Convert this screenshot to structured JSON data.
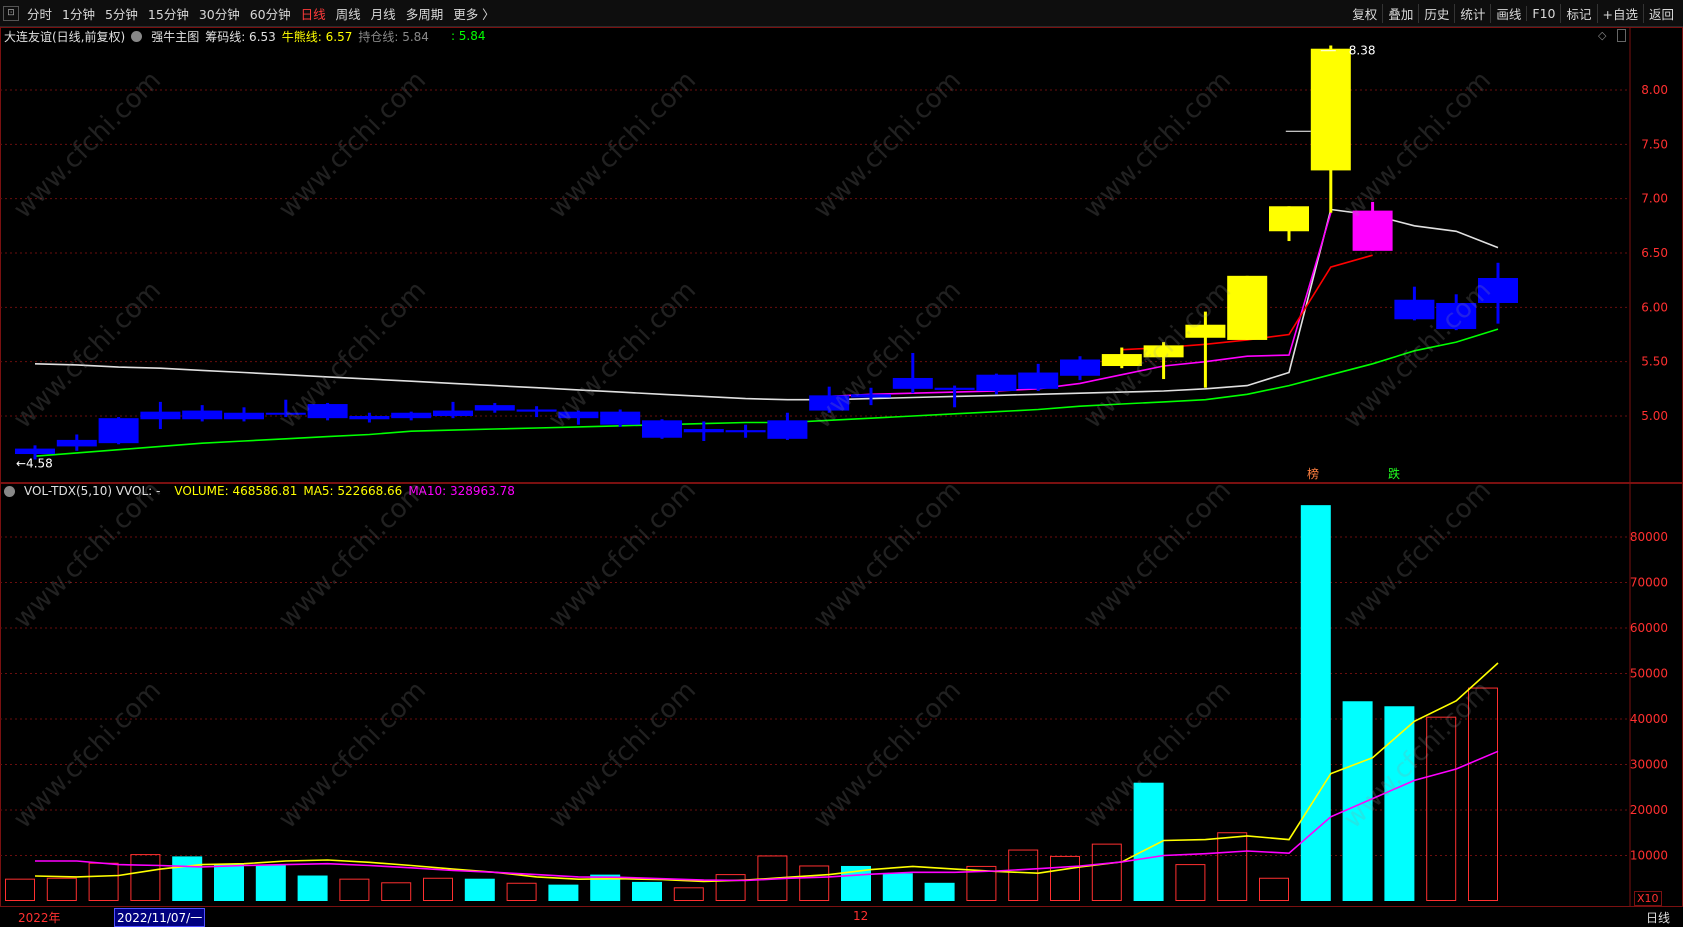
{
  "toolbar": {
    "minimize_glyph": "⊡",
    "periods": [
      "分时",
      "1分钟",
      "5分钟",
      "15分钟",
      "30分钟",
      "60分钟",
      "日线",
      "周线",
      "月线",
      "多周期",
      "更多 〉"
    ],
    "active_period": "日线",
    "tools": [
      "复权",
      "叠加",
      "历史",
      "统计",
      "画线",
      "F10",
      "标记",
      "+自选",
      "返回"
    ]
  },
  "main_panel": {
    "stock_title": "大连友谊(日线,前复权)",
    "indicator_name": "强牛主图",
    "chip_label": "筹码线: 6.53",
    "bull_label": "牛熊线: 6.57",
    "hold_label": "持仓线: 5.84",
    "extra_label": ": 5.84",
    "high_label": "8.38",
    "low_label": "←4.58",
    "marker_bang": "榜",
    "marker_die": "跌",
    "y_ticks": [
      "8.00",
      "7.50",
      "7.00",
      "6.50",
      "6.00",
      "5.50",
      "5.00"
    ]
  },
  "vol_panel": {
    "title": "VOL-TDX(5,10)  VVOL: -",
    "volume_label": "VOLUME: 468586.81",
    "ma5_label": "MA5: 522668.66",
    "ma10_label": "MA10: 328963.78",
    "y_ticks": [
      "80000",
      "70000",
      "60000",
      "50000",
      "40000",
      "30000",
      "20000",
      "10000"
    ],
    "unit": "X10"
  },
  "bottom_axis": {
    "year": "2022年",
    "cursor_date": "2022/11/07/一",
    "month": "12",
    "period_label": "日线"
  },
  "watermark": "www.cfchi.com",
  "colors": {
    "up": "#ffff00",
    "down": "#0000ff",
    "special": "#ff00ff",
    "vol_down": "#00ffff",
    "vol_up": "#ff3030",
    "ma5": "#ffff00",
    "ma10": "#ff00ff",
    "green_line": "#00ff00",
    "red_line": "#ff0000",
    "white_line": "#e0e0e0"
  },
  "chart_data": [
    {
      "type": "candlestick",
      "title": "大连友谊(日线,前复权)",
      "ylim": [
        4.5,
        8.5
      ],
      "candles": [
        {
          "o": 4.7,
          "c": 4.65,
          "h": 4.73,
          "l": 4.6,
          "color": "down"
        },
        {
          "o": 4.78,
          "c": 4.72,
          "h": 4.83,
          "l": 4.68,
          "color": "down"
        },
        {
          "o": 4.98,
          "c": 4.75,
          "h": 4.99,
          "l": 4.74,
          "color": "down"
        },
        {
          "o": 5.04,
          "c": 4.97,
          "h": 5.13,
          "l": 4.88,
          "color": "down"
        },
        {
          "o": 5.05,
          "c": 4.97,
          "h": 5.1,
          "l": 4.95,
          "color": "down"
        },
        {
          "o": 5.03,
          "c": 4.97,
          "h": 5.08,
          "l": 4.95,
          "color": "down"
        },
        {
          "o": 5.03,
          "c": 5.02,
          "h": 5.15,
          "l": 4.99,
          "color": "down"
        },
        {
          "o": 5.11,
          "c": 4.98,
          "h": 5.12,
          "l": 4.96,
          "color": "down"
        },
        {
          "o": 5.0,
          "c": 4.97,
          "h": 5.03,
          "l": 4.94,
          "color": "down"
        },
        {
          "o": 5.03,
          "c": 4.98,
          "h": 5.04,
          "l": 4.96,
          "color": "down"
        },
        {
          "o": 5.05,
          "c": 5.0,
          "h": 5.13,
          "l": 4.98,
          "color": "down"
        },
        {
          "o": 5.1,
          "c": 5.05,
          "h": 5.12,
          "l": 5.03,
          "color": "down"
        },
        {
          "o": 5.06,
          "c": 5.04,
          "h": 5.09,
          "l": 4.99,
          "color": "down"
        },
        {
          "o": 5.04,
          "c": 4.98,
          "h": 5.05,
          "l": 4.92,
          "color": "down"
        },
        {
          "o": 5.04,
          "c": 4.92,
          "h": 5.06,
          "l": 4.9,
          "color": "down"
        },
        {
          "o": 4.96,
          "c": 4.8,
          "h": 4.97,
          "l": 4.79,
          "color": "down"
        },
        {
          "o": 4.88,
          "c": 4.85,
          "h": 4.95,
          "l": 4.77,
          "color": "down"
        },
        {
          "o": 4.87,
          "c": 4.85,
          "h": 4.92,
          "l": 4.8,
          "color": "down"
        },
        {
          "o": 4.96,
          "c": 4.79,
          "h": 5.03,
          "l": 4.78,
          "color": "down"
        },
        {
          "o": 5.19,
          "c": 5.05,
          "h": 5.27,
          "l": 5.03,
          "color": "down"
        },
        {
          "o": 5.2,
          "c": 5.17,
          "h": 5.26,
          "l": 5.1,
          "color": "down"
        },
        {
          "o": 5.35,
          "c": 5.25,
          "h": 5.58,
          "l": 5.21,
          "color": "down"
        },
        {
          "o": 5.26,
          "c": 5.24,
          "h": 5.28,
          "l": 5.08,
          "color": "down"
        },
        {
          "o": 5.38,
          "c": 5.23,
          "h": 5.39,
          "l": 5.2,
          "color": "down"
        },
        {
          "o": 5.4,
          "c": 5.25,
          "h": 5.48,
          "l": 5.23,
          "color": "down"
        },
        {
          "o": 5.52,
          "c": 5.37,
          "h": 5.55,
          "l": 5.33,
          "color": "down"
        },
        {
          "o": 5.46,
          "c": 5.57,
          "h": 5.63,
          "l": 5.44,
          "color": "up"
        },
        {
          "o": 5.54,
          "c": 5.65,
          "h": 5.68,
          "l": 5.34,
          "color": "up"
        },
        {
          "o": 5.72,
          "c": 5.84,
          "h": 5.96,
          "l": 5.26,
          "color": "up"
        },
        {
          "o": 5.7,
          "c": 6.29,
          "h": 6.29,
          "l": 5.7,
          "color": "up"
        },
        {
          "o": 6.7,
          "c": 6.93,
          "h": 6.93,
          "l": 6.61,
          "color": "up"
        },
        {
          "o": 7.26,
          "c": 8.38,
          "h": 8.41,
          "l": 6.87,
          "color": "up"
        },
        {
          "o": 6.89,
          "c": 6.52,
          "h": 6.97,
          "l": 6.52,
          "color": "special"
        },
        {
          "o": 6.07,
          "c": 5.89,
          "h": 6.19,
          "l": 5.88,
          "color": "down"
        },
        {
          "o": 6.04,
          "c": 5.8,
          "h": 6.12,
          "l": 5.79,
          "color": "down"
        },
        {
          "o": 6.27,
          "c": 6.04,
          "h": 6.41,
          "l": 5.85,
          "color": "down"
        }
      ],
      "lines": {
        "white_line": [
          5.48,
          5.47,
          5.45,
          5.44,
          5.42,
          5.4,
          5.38,
          5.36,
          5.34,
          5.32,
          5.3,
          5.28,
          5.26,
          5.24,
          5.22,
          5.2,
          5.18,
          5.16,
          5.15,
          5.15,
          5.16,
          5.17,
          5.18,
          5.19,
          5.2,
          5.21,
          5.22,
          5.23,
          5.25,
          5.28,
          5.4,
          6.9,
          6.85,
          6.75,
          6.7,
          6.55
        ],
        "green_line": [
          4.63,
          4.66,
          4.69,
          4.72,
          4.75,
          4.77,
          4.79,
          4.81,
          4.83,
          4.86,
          4.87,
          4.88,
          4.89,
          4.9,
          4.91,
          4.92,
          4.93,
          4.94,
          4.94,
          4.96,
          4.98,
          5.0,
          5.02,
          5.04,
          5.06,
          5.09,
          5.11,
          5.13,
          5.15,
          5.2,
          5.28,
          5.38,
          5.48,
          5.6,
          5.68,
          5.8
        ],
        "magenta_line": [
          null,
          null,
          null,
          null,
          null,
          null,
          null,
          null,
          null,
          null,
          null,
          null,
          null,
          null,
          null,
          null,
          null,
          null,
          null,
          5.18,
          5.2,
          5.21,
          5.22,
          5.23,
          5.25,
          5.3,
          5.38,
          5.46,
          5.5,
          5.55,
          5.56,
          6.87,
          null,
          null,
          null,
          null
        ],
        "red_line": [
          null,
          null,
          null,
          null,
          null,
          null,
          null,
          null,
          null,
          null,
          null,
          null,
          null,
          null,
          null,
          null,
          null,
          null,
          null,
          null,
          null,
          null,
          null,
          null,
          null,
          null,
          5.61,
          5.63,
          5.66,
          5.7,
          5.75,
          6.37,
          6.48,
          null,
          null,
          null
        ]
      }
    },
    {
      "type": "bar",
      "title": "VOL-TDX(5,10)",
      "ylim": [
        0,
        90000
      ],
      "values": [
        4800,
        5000,
        8300,
        10200,
        9800,
        8100,
        8000,
        5600,
        4800,
        4000,
        5000,
        4900,
        3900,
        3600,
        5800,
        4200,
        2900,
        5800,
        9900,
        7700,
        7700,
        6100,
        4000,
        7600,
        11200,
        9800,
        12500,
        26000,
        8000,
        15000,
        5000,
        87000,
        43900,
        42800,
        40400,
        46800
      ],
      "colors": [
        "up",
        "up",
        "up",
        "up",
        "down",
        "down",
        "down",
        "down",
        "up",
        "up",
        "up",
        "down",
        "up",
        "down",
        "down",
        "down",
        "up",
        "up",
        "up",
        "up",
        "down",
        "down",
        "down",
        "up",
        "up",
        "up",
        "up",
        "down",
        "up",
        "up",
        "up",
        "down",
        "down",
        "down",
        "up",
        "up"
      ],
      "series": [
        {
          "name": "MA5",
          "values": [
            5500,
            5300,
            5600,
            7000,
            8000,
            8200,
            8800,
            9000,
            8500,
            7800,
            7000,
            6300,
            5300,
            4800,
            4900,
            4700,
            4300,
            4600,
            5200,
            5800,
            6900,
            7600,
            7000,
            6500,
            6100,
            7500,
            8600,
            13300,
            13500,
            14300,
            13500,
            28000,
            31500,
            39500,
            44000,
            52300
          ]
        },
        {
          "name": "MA10",
          "values": [
            8800,
            8800,
            8000,
            7800,
            7500,
            7800,
            8000,
            8200,
            7800,
            7300,
            6700,
            6300,
            5800,
            5300,
            5200,
            4900,
            4600,
            4500,
            5000,
            5300,
            5900,
            6300,
            6300,
            6600,
            7100,
            7700,
            8600,
            10000,
            10400,
            11000,
            10500,
            18500,
            22500,
            26500,
            29000,
            32900
          ]
        }
      ]
    }
  ]
}
